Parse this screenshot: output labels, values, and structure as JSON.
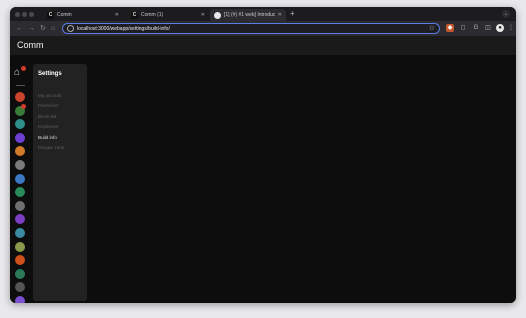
{
  "browser": {
    "tabs": [
      {
        "title": "Comm",
        "favicon": "C",
        "active": false
      },
      {
        "title": "Comm (1)",
        "favicon": "C",
        "active": false
      },
      {
        "title": "[1] (#) #1 web] Introduce...",
        "favicon": "github-icon",
        "active": true
      }
    ],
    "new_tab_label": "+",
    "url": "localhost:3000/webapp/settings/build-info/"
  },
  "app": {
    "title": "Comm",
    "rail": {
      "home_badge": true,
      "avatar_colors": [
        "#c8452b",
        "#3a7d3a",
        "#2f8f8a",
        "#6e3fd3",
        "#d07a2a",
        "#7a7a7a",
        "#3a78c2",
        "#2a8a5a",
        "#6f6f6f",
        "#7a3fc2",
        "#3a8aa2",
        "#8a9a4a",
        "#d0501a",
        "#2a7a5a",
        "#555555",
        "#7a4fd0"
      ],
      "add_label": "+"
    },
    "settings": {
      "title": "Settings",
      "menu": [
        {
          "label": "My account",
          "active": false
        },
        {
          "label": "Friend list",
          "active": false
        },
        {
          "label": "Block list",
          "active": false
        },
        {
          "label": "Keyserver",
          "active": false
        },
        {
          "label": "Build info",
          "active": true
        },
        {
          "label": "Danger zone",
          "active": false
        }
      ]
    }
  }
}
